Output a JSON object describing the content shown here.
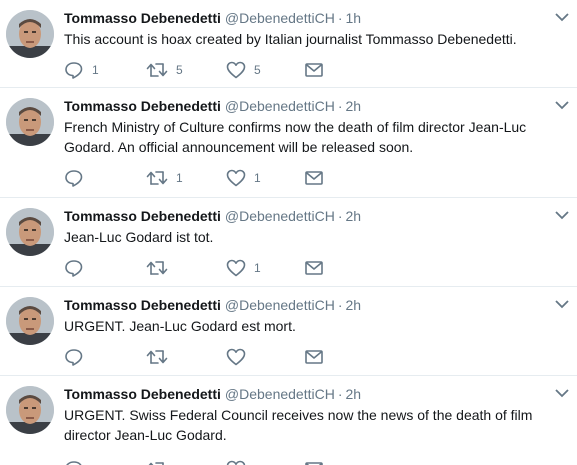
{
  "tweets": [
    {
      "name": "Tommasso Debenedetti",
      "handle": "@DebenedettiCH",
      "time": "1h",
      "text": "This account is hoax created by Italian journalist Tommasso Debenedetti.",
      "replies": "1",
      "retweets": "5",
      "likes": "5"
    },
    {
      "name": "Tommasso Debenedetti",
      "handle": "@DebenedettiCH",
      "time": "2h",
      "text": "French Ministry of Culture confirms now the death of film director Jean-Luc Godard. An official announcement will be released soon.",
      "replies": "",
      "retweets": "1",
      "likes": "1"
    },
    {
      "name": "Tommasso Debenedetti",
      "handle": "@DebenedettiCH",
      "time": "2h",
      "text": "Jean-Luc Godard ist tot.",
      "replies": "",
      "retweets": "",
      "likes": "1"
    },
    {
      "name": "Tommasso Debenedetti",
      "handle": "@DebenedettiCH",
      "time": "2h",
      "text": "URGENT. Jean-Luc Godard est mort.",
      "replies": "",
      "retweets": "",
      "likes": ""
    },
    {
      "name": "Tommasso Debenedetti",
      "handle": "@DebenedettiCH",
      "time": "2h",
      "text": "URGENT. Swiss Federal Council receives now the news of the death of film director Jean-Luc Godard.",
      "replies": "",
      "retweets": "",
      "likes": ""
    }
  ],
  "separator": "·",
  "icons": {
    "reply": "reply-icon",
    "retweet": "retweet-icon",
    "like": "heart-icon",
    "dm": "envelope-icon",
    "menu": "chevron-down-icon"
  },
  "colors": {
    "name": "#14171a",
    "meta": "#657786",
    "divider": "#e6ecf0"
  }
}
